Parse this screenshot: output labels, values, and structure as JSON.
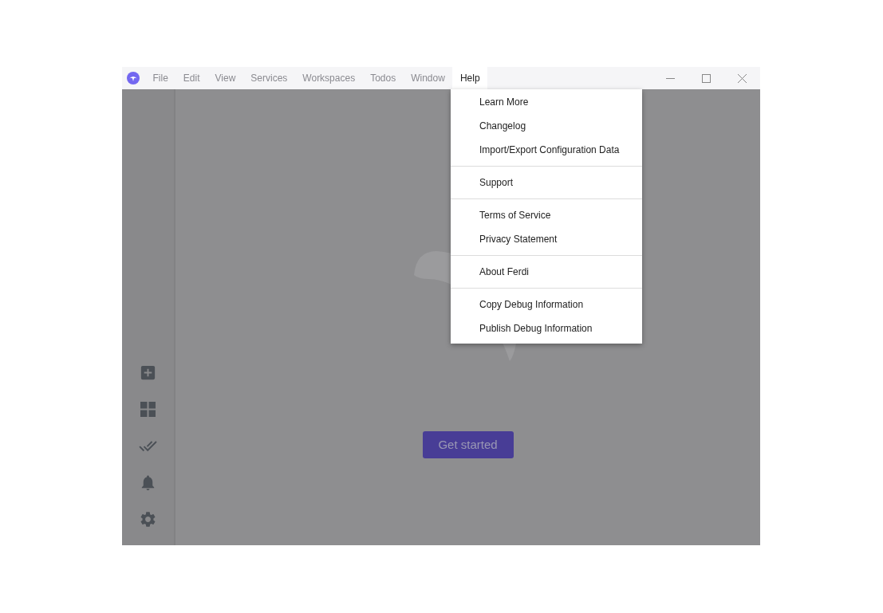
{
  "menubar": [
    {
      "label": "File",
      "selected": false
    },
    {
      "label": "Edit",
      "selected": false
    },
    {
      "label": "View",
      "selected": false
    },
    {
      "label": "Services",
      "selected": false
    },
    {
      "label": "Workspaces",
      "selected": false
    },
    {
      "label": "Todos",
      "selected": false
    },
    {
      "label": "Window",
      "selected": false
    },
    {
      "label": "Help",
      "selected": true
    }
  ],
  "help_menu": [
    [
      "Learn More",
      "Changelog",
      "Import/Export Configuration Data"
    ],
    [
      "Support"
    ],
    [
      "Terms of Service",
      "Privacy Statement"
    ],
    [
      "About Ferdi"
    ],
    [
      "Copy Debug Information",
      "Publish Debug Information"
    ]
  ],
  "get_started_button": "Get started"
}
